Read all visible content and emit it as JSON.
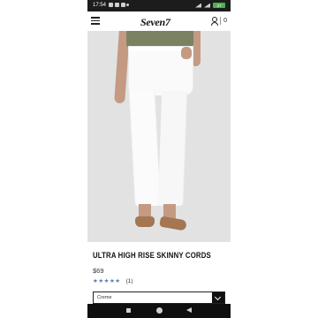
{
  "status_bar": {
    "time": "17:54",
    "battery": "27"
  },
  "header": {
    "logo": "Seven7",
    "cart_count": "0"
  },
  "product": {
    "title": "ULTRA HIGH RISE SKINNY CORDS",
    "price": "$69",
    "rating_stars": "★★★★★",
    "review_count": "(1)",
    "color_select": "Creme"
  },
  "colors": {
    "star": "#5d7fa6",
    "battery": "#4caf50"
  }
}
